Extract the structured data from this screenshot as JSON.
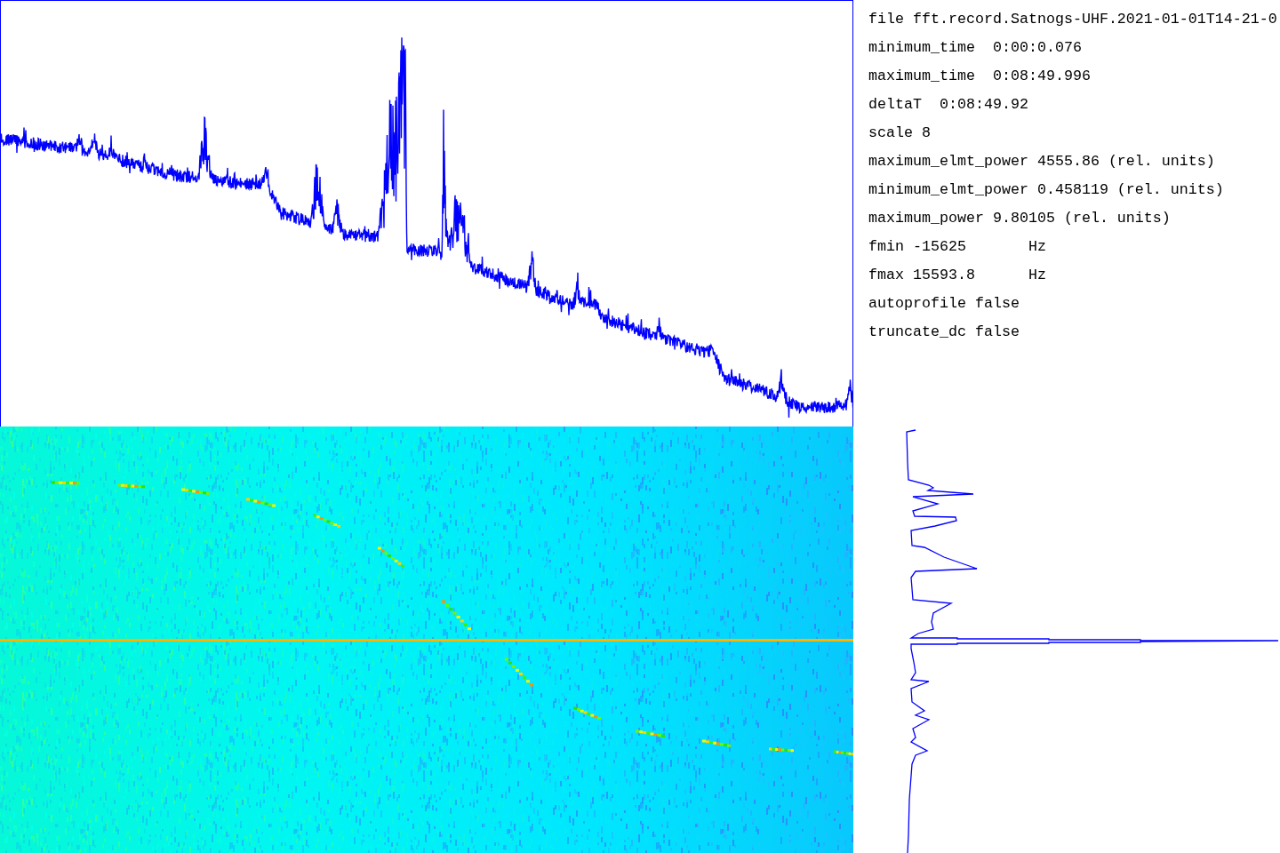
{
  "info": {
    "lines": [
      "file fft.record.Satnogs-UHF.2021-01-01T14-21-0",
      "minimum_time  0:00:0.076",
      "maximum_time  0:08:49.996",
      "deltaT  0:08:49.92",
      "scale 8",
      "maximum_elmt_power 4555.86 (rel. units)",
      "minimum_elmt_power 0.458119 (rel. units)",
      "maximum_power 9.80105 (rel. units)",
      "fmin -15625       Hz",
      "fmax 15593.8      Hz",
      "autoprofile false",
      "truncate_dc false"
    ]
  }
}
